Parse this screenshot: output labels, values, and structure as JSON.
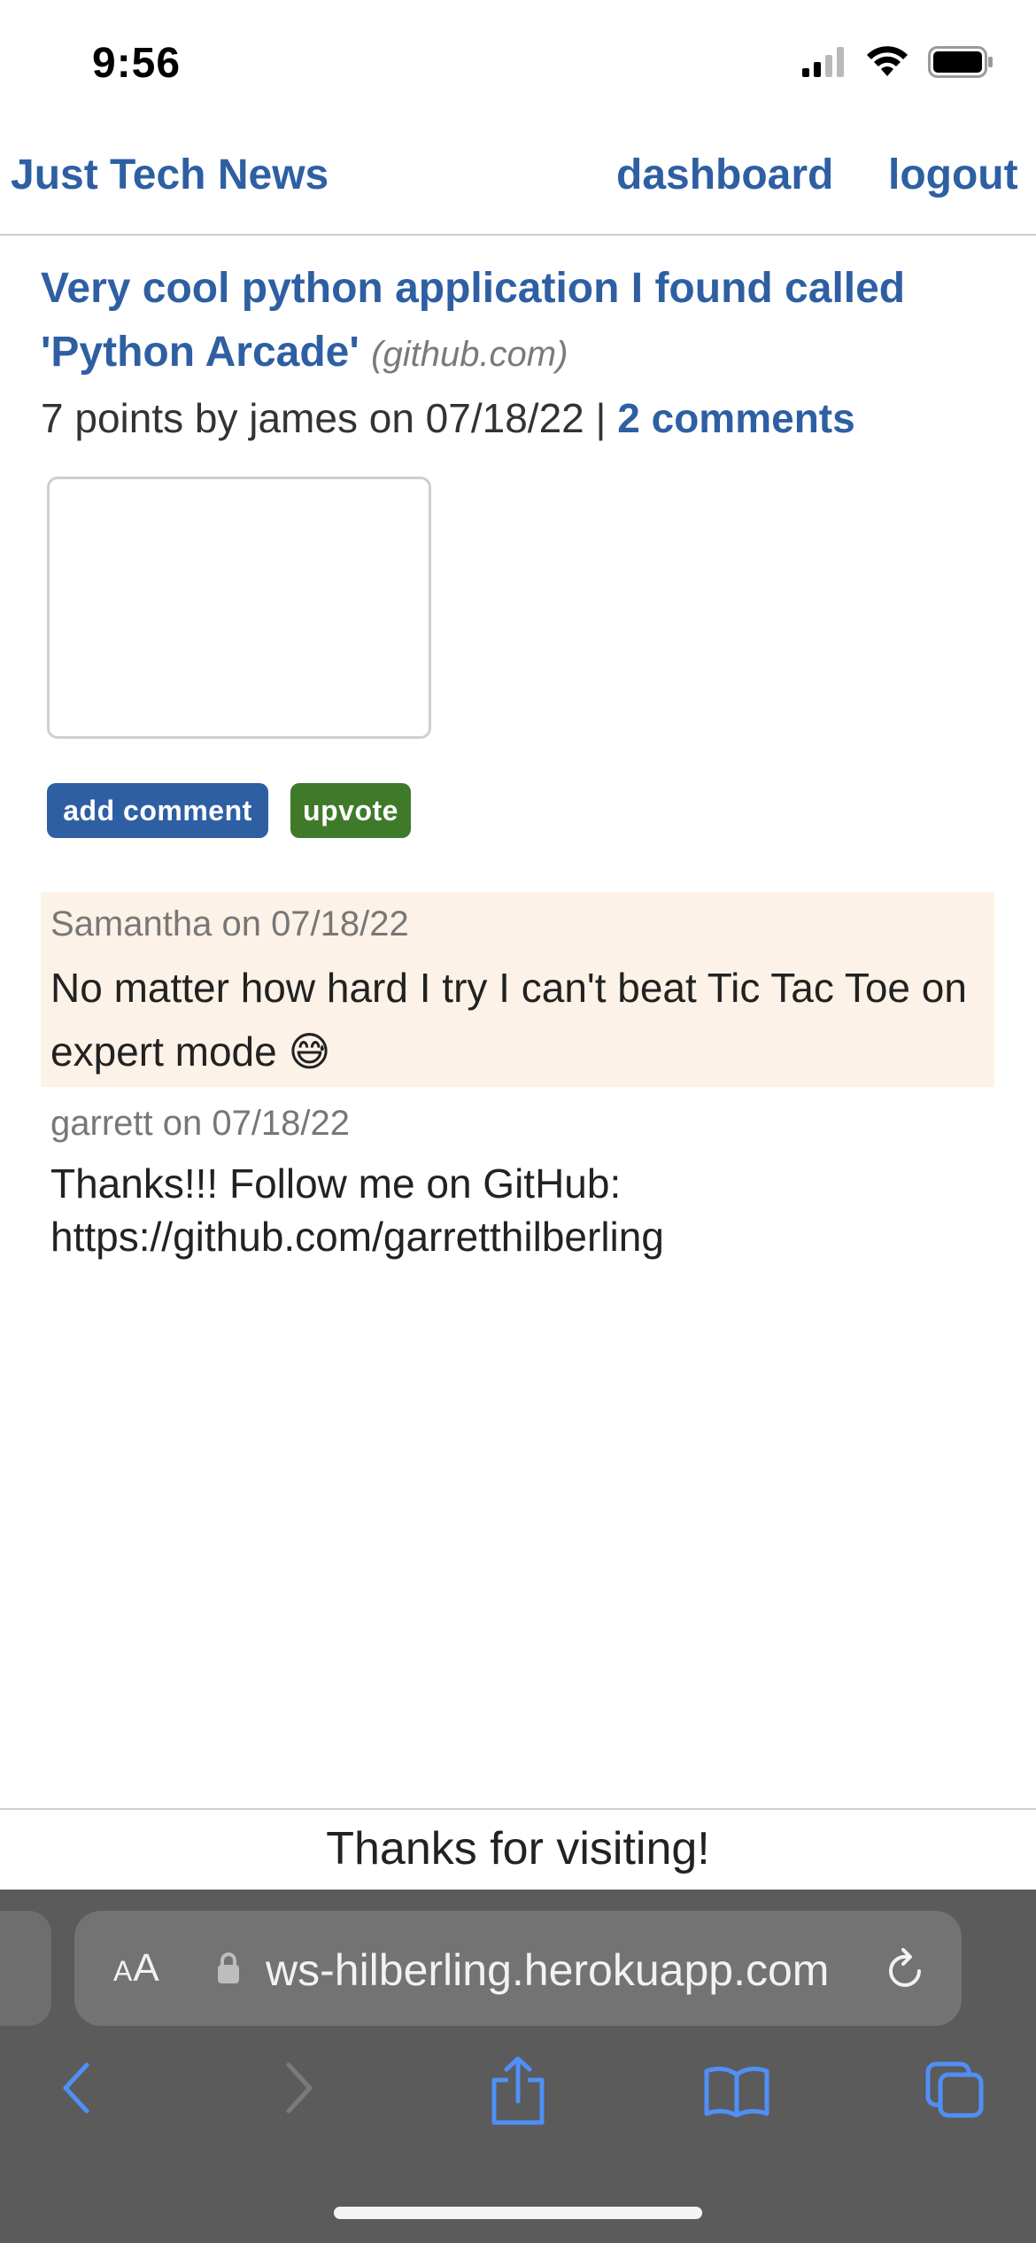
{
  "status_bar": {
    "time": "9:56",
    "icons": [
      "cellular-signal-icon",
      "wifi-icon",
      "battery-icon"
    ]
  },
  "header": {
    "site_title": "Just Tech News",
    "nav": {
      "dashboard": "dashboard",
      "logout": "logout"
    }
  },
  "post": {
    "title": "Very cool python application I found called 'Python Arcade'",
    "domain": "(github.com)",
    "meta_prefix": "7 points by james on 07/18/22 | ",
    "comments_link": "2 comments",
    "comment_input_value": "",
    "add_comment_label": "add comment",
    "upvote_label": "upvote"
  },
  "comments": [
    {
      "author_line": "Samantha on 07/18/22",
      "text": "No matter how hard I try I can't beat Tic Tac Toe on expert mode 😅"
    },
    {
      "author_line": "garrett on 07/18/22",
      "text": "Thanks!!! Follow me on GitHub: https://github.com/garretthilberling"
    }
  ],
  "footer": {
    "text": "Thanks for visiting!"
  },
  "browser": {
    "text_size_label_small": "A",
    "text_size_label_large": "A",
    "url": "ws-hilberling.herokuapp.com",
    "toolbar_icons": [
      "back-icon",
      "forward-icon",
      "share-icon",
      "bookmarks-icon",
      "tabs-icon"
    ]
  },
  "colors": {
    "link_blue": "#2e5fa3",
    "upvote_green": "#3f7a2a",
    "comment_highlight": "#fdf2e8",
    "browser_chrome": "#5b5b5b"
  }
}
